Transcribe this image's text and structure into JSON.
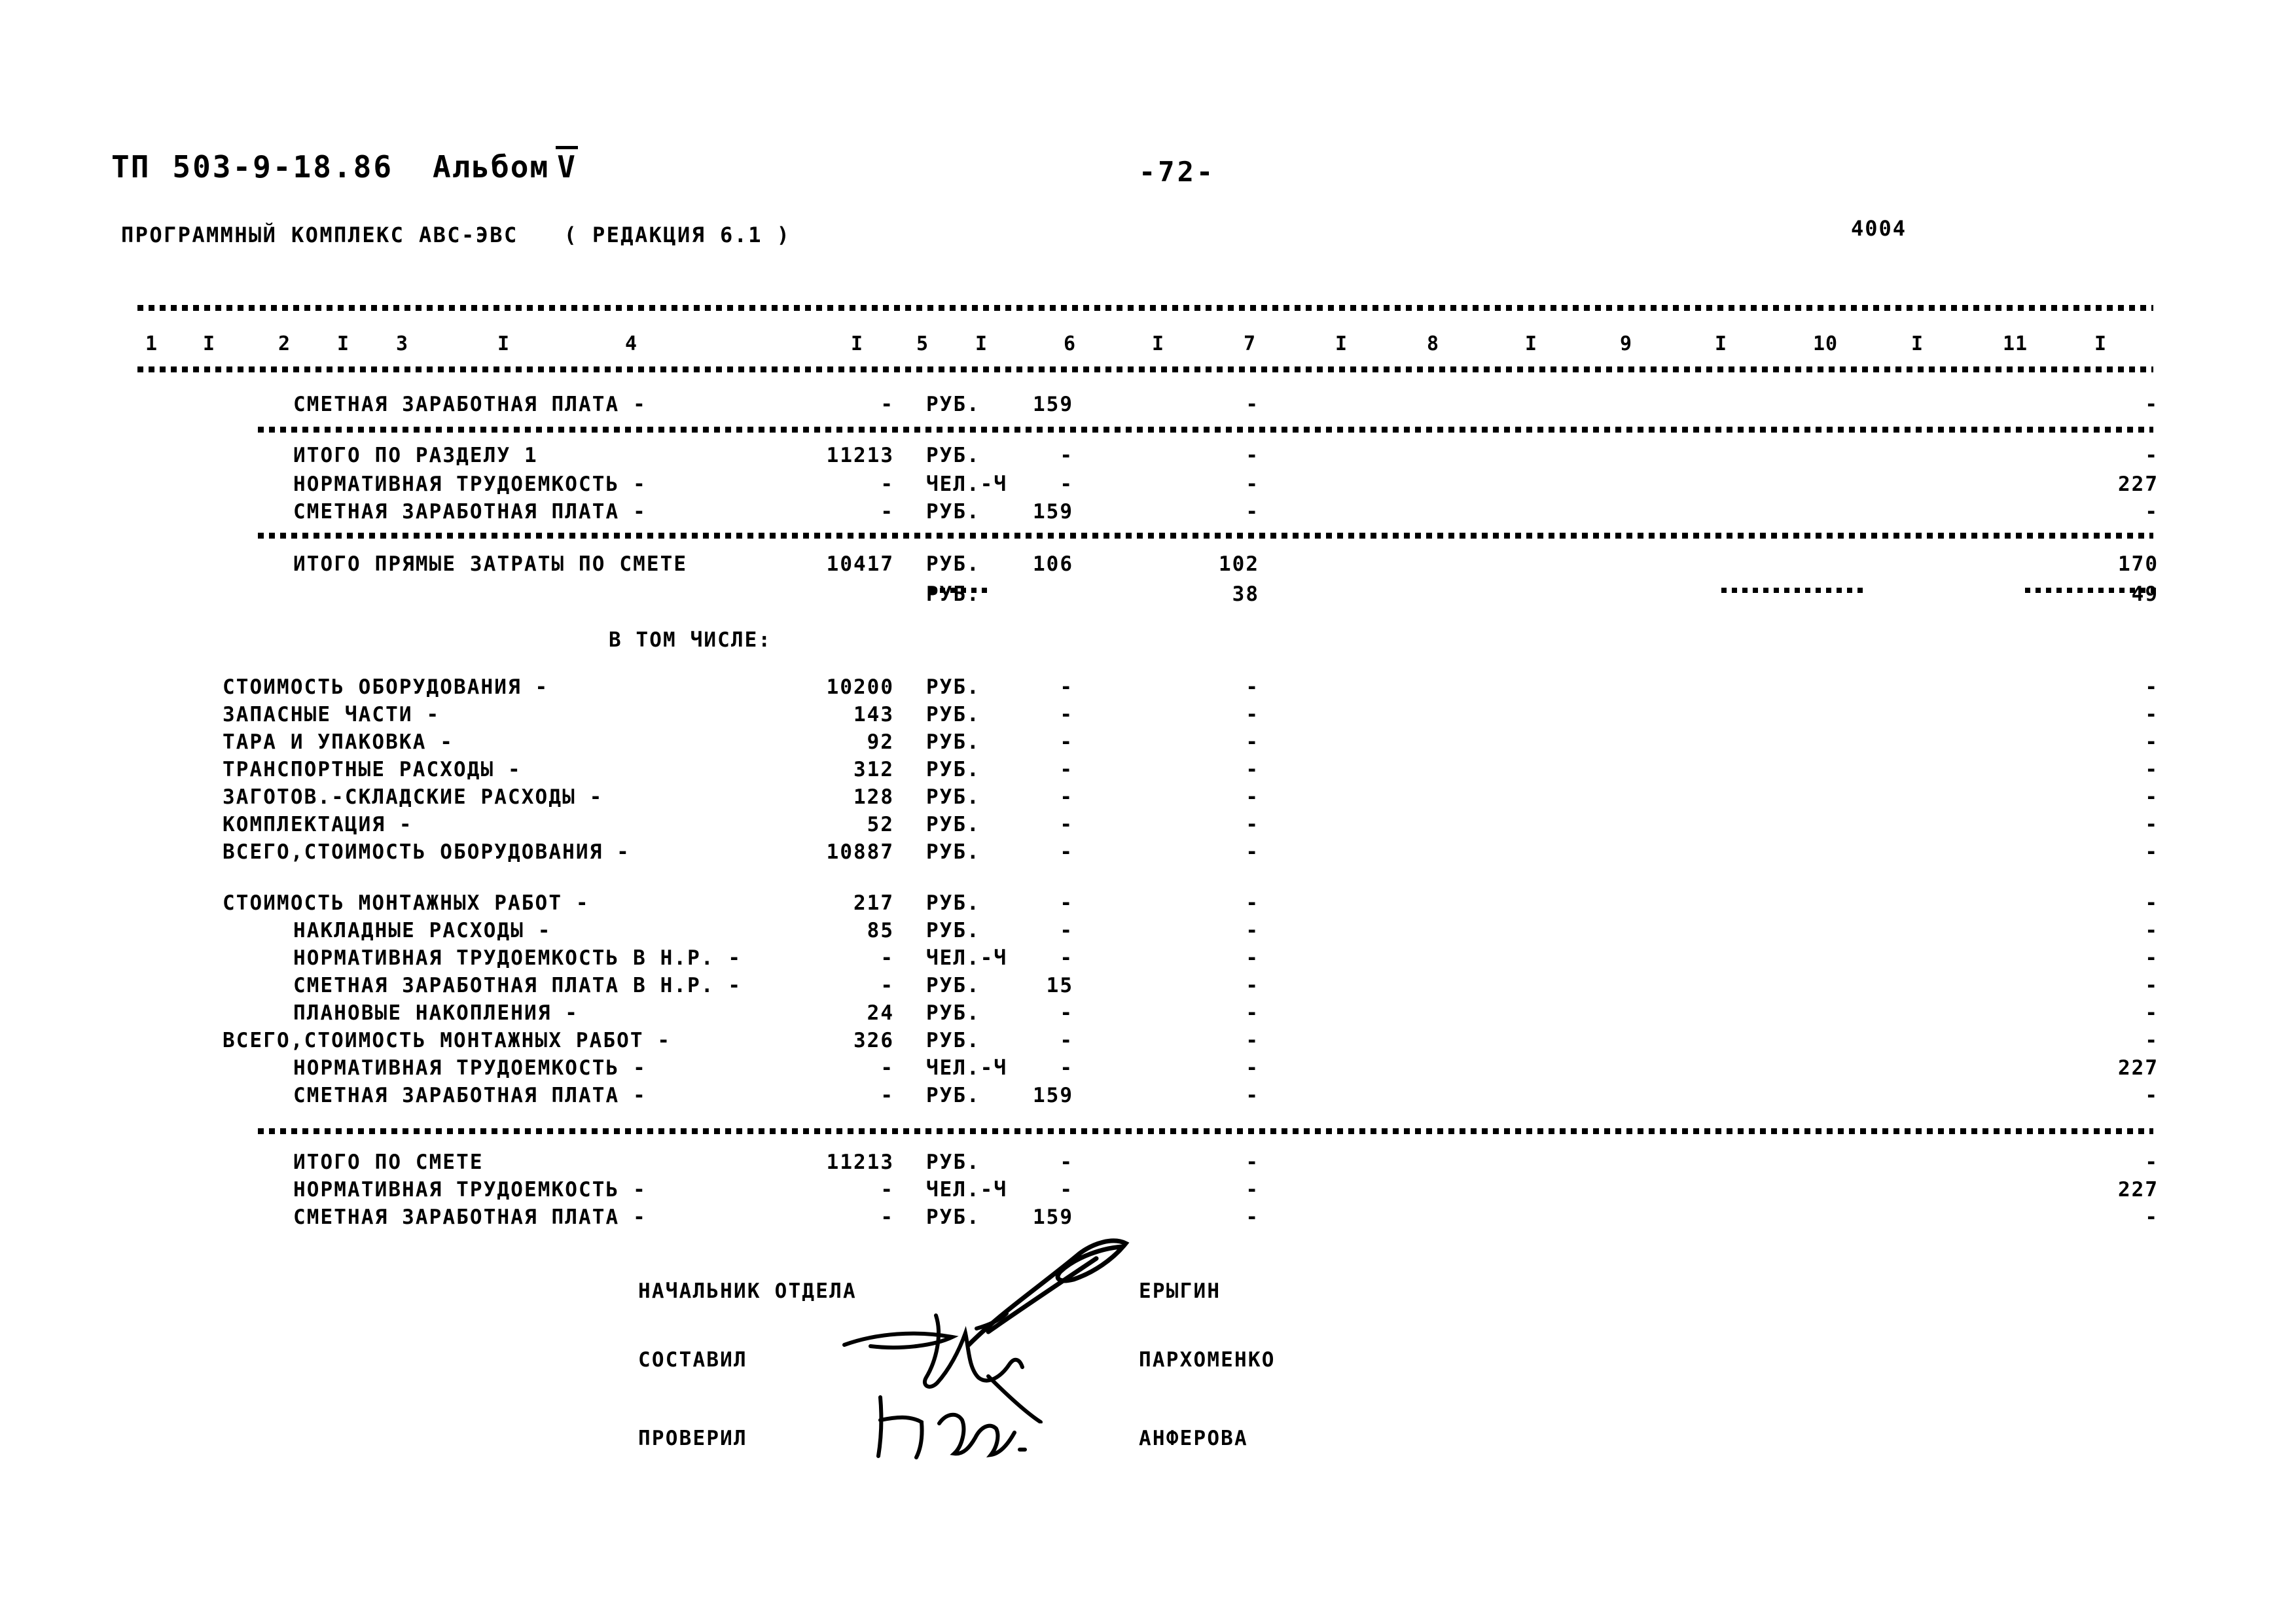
{
  "header": {
    "tp_label": "ТП",
    "project_code": "503-9-18.86",
    "album_label": "Альбом",
    "album_number": "V",
    "page_number": "-72-",
    "doc_code": "4004",
    "subtitle": "ПРОГРАММНЫЙ КОМПЛЕКС АВС-ЭВС",
    "revision": "( РЕДАКЦИЯ  6.1 )"
  },
  "table": {
    "column_headers": [
      "1",
      "2",
      "3",
      "4",
      "5",
      "6",
      "7",
      "8",
      "9",
      "10",
      "11"
    ],
    "separator": "I",
    "rows": [
      {
        "label": "СМЕТНАЯ ЗАРАБОТНАЯ ПЛАТА -",
        "indent": "ind1",
        "unit": "РУБ.",
        "c7": "-",
        "c8": "159",
        "c9": "-",
        "c11": "-"
      },
      {
        "label": "ИТОГО ПО РАЗДЕЛУ          1",
        "indent": "ind1",
        "unit": "РУБ.",
        "c7": "11213",
        "c8": "-",
        "c9": "-",
        "c11": "-"
      },
      {
        "label": "НОРМАТИВНАЯ ТРУДОЕМКОСТЬ -",
        "indent": "ind1",
        "unit": "ЧЕЛ.-Ч",
        "c7": "-",
        "c8": "-",
        "c9": "-",
        "c11": "227"
      },
      {
        "label": "СМЕТНАЯ ЗАРАБОТНАЯ ПЛАТА -",
        "indent": "ind1",
        "unit": "РУБ.",
        "c7": "-",
        "c8": "159",
        "c9": "-",
        "c11": "-"
      },
      {
        "label": "ИТОГО ПРЯМЫЕ ЗАТРАТЫ ПО СМЕТЕ",
        "indent": "ind1",
        "unit": "РУБ.",
        "c7": "10417",
        "c8": "106",
        "c9": "102",
        "c11": "170"
      },
      {
        "label": "",
        "indent": "ind1",
        "unit": "РУБ.",
        "c7": "",
        "c8": "",
        "c9": "38",
        "c11": "49"
      },
      {
        "label": "В ТОМ ЧИСЛЕ:",
        "indent": "center",
        "unit": "",
        "c7": "",
        "c8": "",
        "c9": "",
        "c11": ""
      },
      {
        "label": "СТОИМОСТЬ ОБОРУДОВАНИЯ -",
        "indent": "ind2",
        "unit": "РУБ.",
        "c7": "10200",
        "c8": "-",
        "c9": "-",
        "c11": "-"
      },
      {
        "label": "ЗАПАСНЫЕ ЧАСТИ -",
        "indent": "ind2",
        "unit": "РУБ.",
        "c7": "143",
        "c8": "-",
        "c9": "-",
        "c11": "-"
      },
      {
        "label": "ТАРА И УПАКОВКА -",
        "indent": "ind2",
        "unit": "РУБ.",
        "c7": "92",
        "c8": "-",
        "c9": "-",
        "c11": "-"
      },
      {
        "label": "ТРАНСПОРТНЫЕ РАСХОДЫ -",
        "indent": "ind2",
        "unit": "РУБ.",
        "c7": "312",
        "c8": "-",
        "c9": "-",
        "c11": "-"
      },
      {
        "label": "ЗАГОТОВ.-СКЛАДСКИЕ РАСХОДЫ -",
        "indent": "ind2",
        "unit": "РУБ.",
        "c7": "128",
        "c8": "-",
        "c9": "-",
        "c11": "-"
      },
      {
        "label": "КОМПЛЕКТАЦИЯ -",
        "indent": "ind2",
        "unit": "РУБ.",
        "c7": "52",
        "c8": "-",
        "c9": "-",
        "c11": "-"
      },
      {
        "label": "ВСЕГО,СТОИМОСТЬ ОБОРУДОВАНИЯ -",
        "indent": "ind2",
        "unit": "РУБ.",
        "c7": "10887",
        "c8": "-",
        "c9": "-",
        "c11": "-"
      },
      {
        "label": "СТОИМОСТЬ МОНТАЖНЫХ РАБОТ -",
        "indent": "ind2",
        "unit": "РУБ.",
        "c7": "217",
        "c8": "-",
        "c9": "-",
        "c11": "-"
      },
      {
        "label": "НАКЛАДНЫЕ РАСХОДЫ -",
        "indent": "ind1",
        "unit": "РУБ.",
        "c7": "85",
        "c8": "-",
        "c9": "-",
        "c11": "-"
      },
      {
        "label": "НОРМАТИВНАЯ ТРУДОЕМКОСТЬ В Н.Р. -",
        "indent": "ind1",
        "unit": "ЧЕЛ.-Ч",
        "c7": "-",
        "c8": "-",
        "c9": "-",
        "c11": "-"
      },
      {
        "label": "СМЕТНАЯ ЗАРАБОТНАЯ ПЛАТА В Н.Р. -",
        "indent": "ind1",
        "unit": "РУБ.",
        "c7": "-",
        "c8": "15",
        "c9": "-",
        "c11": "-"
      },
      {
        "label": "ПЛАНОВЫЕ НАКОПЛЕНИЯ -",
        "indent": "ind1",
        "unit": "РУБ.",
        "c7": "24",
        "c8": "-",
        "c9": "-",
        "c11": "-"
      },
      {
        "label": "ВСЕГО,СТОИМОСТЬ МОНТАЖНЫХ РАБОТ -",
        "indent": "ind2",
        "unit": "РУБ.",
        "c7": "326",
        "c8": "-",
        "c9": "-",
        "c11": "-"
      },
      {
        "label": "НОРМАТИВНАЯ ТРУДОЕМКОСТЬ -",
        "indent": "ind1",
        "unit": "ЧЕЛ.-Ч",
        "c7": "-",
        "c8": "-",
        "c9": "-",
        "c11": "227"
      },
      {
        "label": "СМЕТНАЯ ЗАРАБОТНАЯ ПЛАТА -",
        "indent": "ind1",
        "unit": "РУБ.",
        "c7": "-",
        "c8": "159",
        "c9": "-",
        "c11": "-"
      },
      {
        "label": "ИТОГО ПО СМЕТЕ",
        "indent": "ind1",
        "unit": "РУБ.",
        "c7": "11213",
        "c8": "-",
        "c9": "-",
        "c11": "-"
      },
      {
        "label": "НОРМАТИВНАЯ ТРУДОЕМКОСТЬ -",
        "indent": "ind1",
        "unit": "ЧЕЛ.-Ч",
        "c7": "-",
        "c8": "-",
        "c9": "-",
        "c11": "227"
      },
      {
        "label": "СМЕТНАЯ ЗАРАБОТНАЯ ПЛАТА -",
        "indent": "ind1",
        "unit": "РУБ.",
        "c7": "-",
        "c8": "159",
        "c9": "-",
        "c11": "-"
      }
    ]
  },
  "signatures": [
    {
      "role": "НАЧАЛЬНИК ОТДЕЛА",
      "name": "ЕРЫГИН"
    },
    {
      "role": "СОСТАВИЛ",
      "name": "ПАРХОМЕНКО"
    },
    {
      "role": "ПРОВЕРИЛ",
      "name": "АНФЕРОВА"
    }
  ]
}
